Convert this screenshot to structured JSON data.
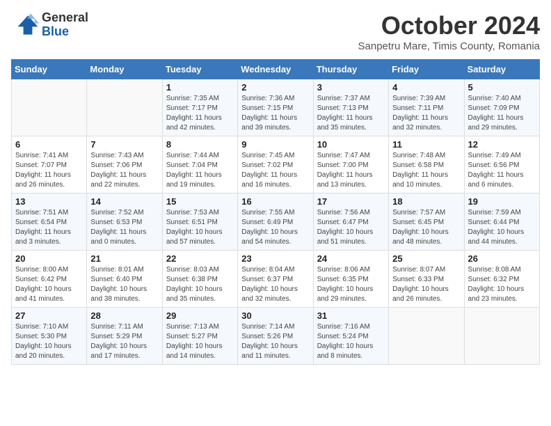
{
  "header": {
    "logo_line1": "General",
    "logo_line2": "Blue",
    "month": "October 2024",
    "location": "Sanpetru Mare, Timis County, Romania"
  },
  "days_of_week": [
    "Sunday",
    "Monday",
    "Tuesday",
    "Wednesday",
    "Thursday",
    "Friday",
    "Saturday"
  ],
  "weeks": [
    [
      {
        "day": "",
        "detail": ""
      },
      {
        "day": "",
        "detail": ""
      },
      {
        "day": "1",
        "detail": "Sunrise: 7:35 AM\nSunset: 7:17 PM\nDaylight: 11 hours and 42 minutes."
      },
      {
        "day": "2",
        "detail": "Sunrise: 7:36 AM\nSunset: 7:15 PM\nDaylight: 11 hours and 39 minutes."
      },
      {
        "day": "3",
        "detail": "Sunrise: 7:37 AM\nSunset: 7:13 PM\nDaylight: 11 hours and 35 minutes."
      },
      {
        "day": "4",
        "detail": "Sunrise: 7:39 AM\nSunset: 7:11 PM\nDaylight: 11 hours and 32 minutes."
      },
      {
        "day": "5",
        "detail": "Sunrise: 7:40 AM\nSunset: 7:09 PM\nDaylight: 11 hours and 29 minutes."
      }
    ],
    [
      {
        "day": "6",
        "detail": "Sunrise: 7:41 AM\nSunset: 7:07 PM\nDaylight: 11 hours and 26 minutes."
      },
      {
        "day": "7",
        "detail": "Sunrise: 7:43 AM\nSunset: 7:06 PM\nDaylight: 11 hours and 22 minutes."
      },
      {
        "day": "8",
        "detail": "Sunrise: 7:44 AM\nSunset: 7:04 PM\nDaylight: 11 hours and 19 minutes."
      },
      {
        "day": "9",
        "detail": "Sunrise: 7:45 AM\nSunset: 7:02 PM\nDaylight: 11 hours and 16 minutes."
      },
      {
        "day": "10",
        "detail": "Sunrise: 7:47 AM\nSunset: 7:00 PM\nDaylight: 11 hours and 13 minutes."
      },
      {
        "day": "11",
        "detail": "Sunrise: 7:48 AM\nSunset: 6:58 PM\nDaylight: 11 hours and 10 minutes."
      },
      {
        "day": "12",
        "detail": "Sunrise: 7:49 AM\nSunset: 6:56 PM\nDaylight: 11 hours and 6 minutes."
      }
    ],
    [
      {
        "day": "13",
        "detail": "Sunrise: 7:51 AM\nSunset: 6:54 PM\nDaylight: 11 hours and 3 minutes."
      },
      {
        "day": "14",
        "detail": "Sunrise: 7:52 AM\nSunset: 6:53 PM\nDaylight: 11 hours and 0 minutes."
      },
      {
        "day": "15",
        "detail": "Sunrise: 7:53 AM\nSunset: 6:51 PM\nDaylight: 10 hours and 57 minutes."
      },
      {
        "day": "16",
        "detail": "Sunrise: 7:55 AM\nSunset: 6:49 PM\nDaylight: 10 hours and 54 minutes."
      },
      {
        "day": "17",
        "detail": "Sunrise: 7:56 AM\nSunset: 6:47 PM\nDaylight: 10 hours and 51 minutes."
      },
      {
        "day": "18",
        "detail": "Sunrise: 7:57 AM\nSunset: 6:45 PM\nDaylight: 10 hours and 48 minutes."
      },
      {
        "day": "19",
        "detail": "Sunrise: 7:59 AM\nSunset: 6:44 PM\nDaylight: 10 hours and 44 minutes."
      }
    ],
    [
      {
        "day": "20",
        "detail": "Sunrise: 8:00 AM\nSunset: 6:42 PM\nDaylight: 10 hours and 41 minutes."
      },
      {
        "day": "21",
        "detail": "Sunrise: 8:01 AM\nSunset: 6:40 PM\nDaylight: 10 hours and 38 minutes."
      },
      {
        "day": "22",
        "detail": "Sunrise: 8:03 AM\nSunset: 6:38 PM\nDaylight: 10 hours and 35 minutes."
      },
      {
        "day": "23",
        "detail": "Sunrise: 8:04 AM\nSunset: 6:37 PM\nDaylight: 10 hours and 32 minutes."
      },
      {
        "day": "24",
        "detail": "Sunrise: 8:06 AM\nSunset: 6:35 PM\nDaylight: 10 hours and 29 minutes."
      },
      {
        "day": "25",
        "detail": "Sunrise: 8:07 AM\nSunset: 6:33 PM\nDaylight: 10 hours and 26 minutes."
      },
      {
        "day": "26",
        "detail": "Sunrise: 8:08 AM\nSunset: 6:32 PM\nDaylight: 10 hours and 23 minutes."
      }
    ],
    [
      {
        "day": "27",
        "detail": "Sunrise: 7:10 AM\nSunset: 5:30 PM\nDaylight: 10 hours and 20 minutes."
      },
      {
        "day": "28",
        "detail": "Sunrise: 7:11 AM\nSunset: 5:29 PM\nDaylight: 10 hours and 17 minutes."
      },
      {
        "day": "29",
        "detail": "Sunrise: 7:13 AM\nSunset: 5:27 PM\nDaylight: 10 hours and 14 minutes."
      },
      {
        "day": "30",
        "detail": "Sunrise: 7:14 AM\nSunset: 5:26 PM\nDaylight: 10 hours and 11 minutes."
      },
      {
        "day": "31",
        "detail": "Sunrise: 7:16 AM\nSunset: 5:24 PM\nDaylight: 10 hours and 8 minutes."
      },
      {
        "day": "",
        "detail": ""
      },
      {
        "day": "",
        "detail": ""
      }
    ]
  ]
}
